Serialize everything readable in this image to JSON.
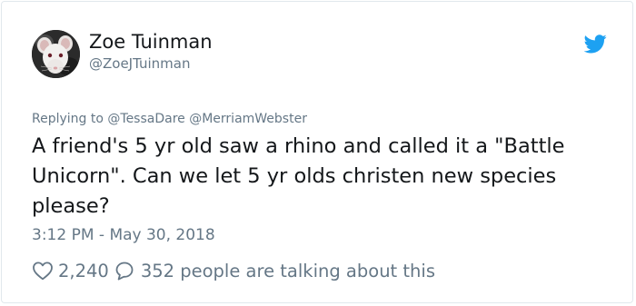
{
  "author": {
    "display_name": "Zoe Tuinman",
    "handle": "@ZoeJTuinman",
    "avatar": "rat-photo-avatar"
  },
  "logo_icon": "twitter-bird-icon",
  "colors": {
    "brand_blue": "#1da1f2",
    "text_primary": "#14171a",
    "text_secondary": "#657786",
    "border": "#e1e8ed"
  },
  "reply_context": {
    "prefix": "Replying to",
    "mentions": [
      "@TessaDare",
      "@MerriamWebster"
    ]
  },
  "tweet": {
    "text": "A friend's 5 yr old saw a rhino and called it a \"Battle Unicorn\". Can we let 5 yr olds christen new species please?",
    "timestamp": "3:12 PM - May 30, 2018"
  },
  "actions": {
    "like_icon": "heart-icon",
    "like_count": "2,240",
    "reply_icon": "speech-bubble-icon",
    "talking_text": "352 people are talking about this"
  }
}
